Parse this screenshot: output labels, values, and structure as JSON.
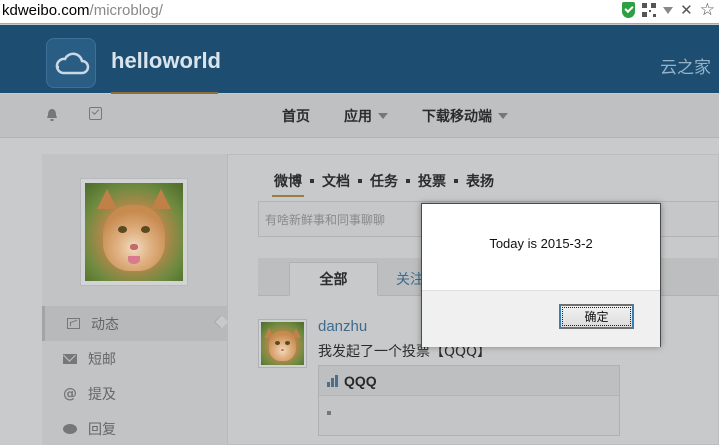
{
  "browser": {
    "url_host": "kdweibo.com",
    "url_path": "/microblog/",
    "icons": [
      "shield-icon",
      "qr-code-icon",
      "dropdown-arrow-icon",
      "close-icon",
      "star-icon"
    ]
  },
  "header": {
    "logo_icon": "cloud-icon",
    "brand": "helloworld",
    "right_link": "云之家"
  },
  "navbar": {
    "left_icons": [
      "bell-icon",
      "edit-icon"
    ],
    "items": [
      {
        "label": "首页",
        "has_caret": false
      },
      {
        "label": "应用",
        "has_caret": true
      },
      {
        "label": "下载移动端",
        "has_caret": true
      }
    ]
  },
  "sidebar": {
    "items": [
      {
        "label": "动态",
        "icon": "chart-icon",
        "active": true
      },
      {
        "label": "短邮",
        "icon": "mail-icon",
        "active": false
      },
      {
        "label": "提及",
        "icon": "at-icon",
        "active": false
      },
      {
        "label": "回复",
        "icon": "chat-icon",
        "active": false
      }
    ]
  },
  "composer": {
    "tabs": [
      "微博",
      "文档",
      "任务",
      "投票",
      "表扬"
    ],
    "placeholder": "有啥新鲜事和同事聊聊"
  },
  "feed": {
    "tabs": [
      "全部",
      "关注"
    ],
    "post": {
      "user": "danzhu",
      "text": "我发起了一个投票【QQQ】",
      "vote_title": "QQQ"
    }
  },
  "dialog": {
    "message": "Today is 2015-3-2",
    "ok_label": "确定"
  },
  "colors": {
    "header_bg": "#1d4e72",
    "dialog_bg": "#ffffff",
    "link": "#3d6c8e",
    "accent_underline": "#9a7c45"
  }
}
